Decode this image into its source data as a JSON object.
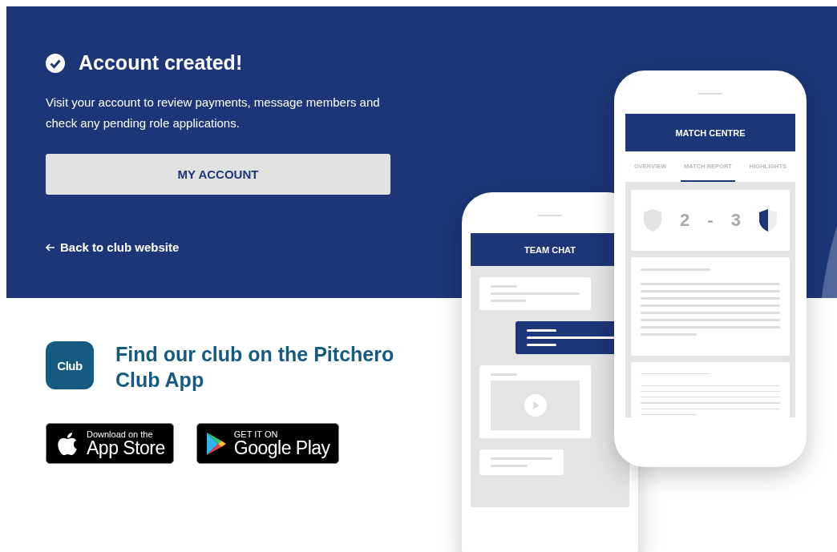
{
  "header": {
    "title": "Account created!",
    "message": "Visit your account to review payments, message members and check any pending role applications.",
    "button": "MY ACCOUNT",
    "back_link": "Back to club website"
  },
  "app_promo": {
    "icon_label": "Club",
    "heading": "Find our club on the Pitchero Club App",
    "badges": [
      {
        "kind": "apple",
        "small": "Download on the",
        "large": "App Store"
      },
      {
        "kind": "google",
        "small": "GET IT ON",
        "large": "Google Play"
      }
    ]
  },
  "illustration": {
    "chat_phone": {
      "title": "TEAM CHAT"
    },
    "match_phone": {
      "title": "MATCH CENTRE",
      "tabs": [
        {
          "label": "OVERVIEW",
          "selected": false
        },
        {
          "label": "MATCH REPORT",
          "selected": true
        },
        {
          "label": "HIGHLIGHTS",
          "selected": false
        }
      ],
      "home_score": "2",
      "separator": "-",
      "away_score": "3"
    }
  }
}
